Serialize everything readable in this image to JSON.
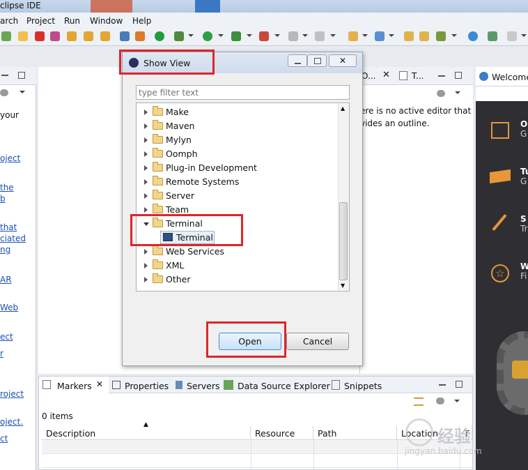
{
  "window": {
    "title": "clipse IDE"
  },
  "menu": {
    "items": [
      "arch",
      "Project",
      "Run",
      "Window",
      "Help"
    ]
  },
  "left_panel": {
    "lines": [
      {
        "text": "your",
        "link": false
      },
      {
        "text": "oject",
        "link": true
      },
      {
        "text": "the",
        "link": true
      },
      {
        "text": "b",
        "link": true
      },
      {
        "text": "that",
        "link": true
      },
      {
        "text": "ciated",
        "link": true
      },
      {
        "text": "ng",
        "link": true
      },
      {
        "text": "AR",
        "link": true
      },
      {
        "text": "Web",
        "link": true
      },
      {
        "text": "ect",
        "link": true
      },
      {
        "text": "r",
        "link": true
      },
      {
        "text": "roject",
        "link": true
      },
      {
        "text": "oject.",
        "link": true
      },
      {
        "text": "ct",
        "link": true
      }
    ]
  },
  "outline": {
    "tab_labels": [
      "O...",
      "T..."
    ],
    "message_line1": "ere is no active editor that",
    "message_line2": "vides an outline."
  },
  "welcome": {
    "tab_label": "Welcome",
    "items": [
      {
        "title": "O",
        "sub": "G"
      },
      {
        "title": "Tu",
        "sub": "G"
      },
      {
        "title": "S",
        "sub": "Tr"
      },
      {
        "title": "W",
        "sub": "Fi"
      }
    ]
  },
  "dialog": {
    "title": "Show View",
    "filter_placeholder": "type filter text",
    "tree": [
      {
        "label": "Make",
        "expanded": false
      },
      {
        "label": "Maven",
        "expanded": false
      },
      {
        "label": "Mylyn",
        "expanded": false
      },
      {
        "label": "Oomph",
        "expanded": false
      },
      {
        "label": "Plug-in Development",
        "expanded": false
      },
      {
        "label": "Remote Systems",
        "expanded": false
      },
      {
        "label": "Server",
        "expanded": false
      },
      {
        "label": "Team",
        "expanded": false
      },
      {
        "label": "Terminal",
        "expanded": true
      },
      {
        "label": "Terminal",
        "child": true,
        "selected": true
      },
      {
        "label": "Web Services",
        "expanded": false
      },
      {
        "label": "XML",
        "expanded": false
      },
      {
        "label": "Other",
        "expanded": false
      }
    ],
    "open_label": "Open",
    "cancel_label": "Cancel"
  },
  "bottom": {
    "tabs": [
      "Markers",
      "Properties",
      "Servers",
      "Data Source Explorer",
      "Snippets"
    ],
    "items_count": "0 items",
    "columns": [
      "Description",
      "Resource",
      "Path",
      "Location",
      "T"
    ]
  },
  "watermark": {
    "line1": "经验",
    "line2": "jingyan.baidu.com"
  },
  "colors": {
    "highlight": "#e0242a",
    "link": "#1a4fb5",
    "accent": "#4a90d9"
  }
}
